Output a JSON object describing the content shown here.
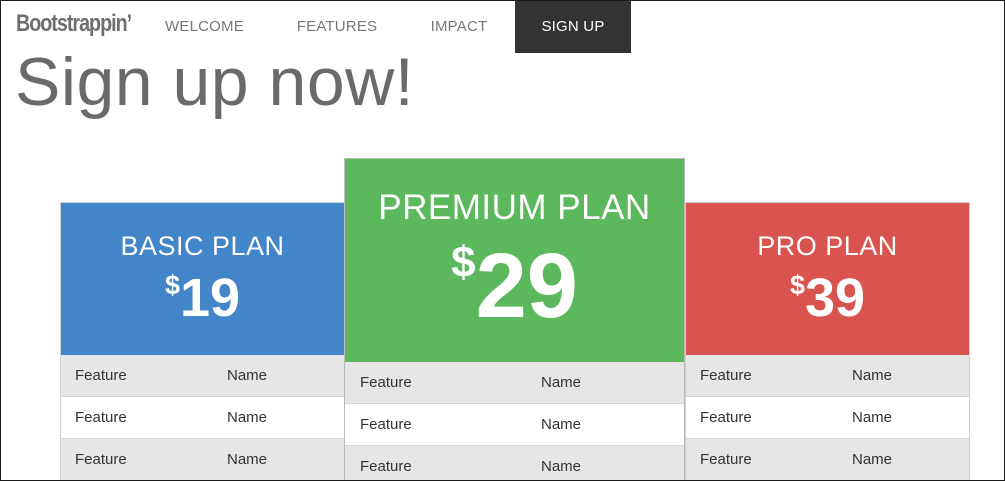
{
  "navbar": {
    "brand": "Bootstrappin’",
    "items": [
      {
        "label": "WELCOME",
        "active": false
      },
      {
        "label": "FEATURES",
        "active": false
      },
      {
        "label": "IMPACT",
        "active": false
      },
      {
        "label": "SIGN UP",
        "active": true
      }
    ]
  },
  "hero": {
    "title": "Sign up now!"
  },
  "plans": [
    {
      "name": "BASIC PLAN",
      "currency": "$",
      "price": "19",
      "color": "#4285c8",
      "features": [
        {
          "c1": "Feature",
          "c2": "Name"
        },
        {
          "c1": "Feature",
          "c2": "Name"
        },
        {
          "c1": "Feature",
          "c2": "Name"
        }
      ]
    },
    {
      "name": "PREMIUM PLAN",
      "currency": "$",
      "price": "29",
      "color": "#5cb85c",
      "features": [
        {
          "c1": "Feature",
          "c2": "Name"
        },
        {
          "c1": "Feature",
          "c2": "Name"
        },
        {
          "c1": "Feature",
          "c2": "Name"
        }
      ]
    },
    {
      "name": "PRO PLAN",
      "currency": "$",
      "price": "39",
      "color": "#d9534f",
      "features": [
        {
          "c1": "Feature",
          "c2": "Name"
        },
        {
          "c1": "Feature",
          "c2": "Name"
        },
        {
          "c1": "Feature",
          "c2": "Name"
        }
      ]
    }
  ]
}
